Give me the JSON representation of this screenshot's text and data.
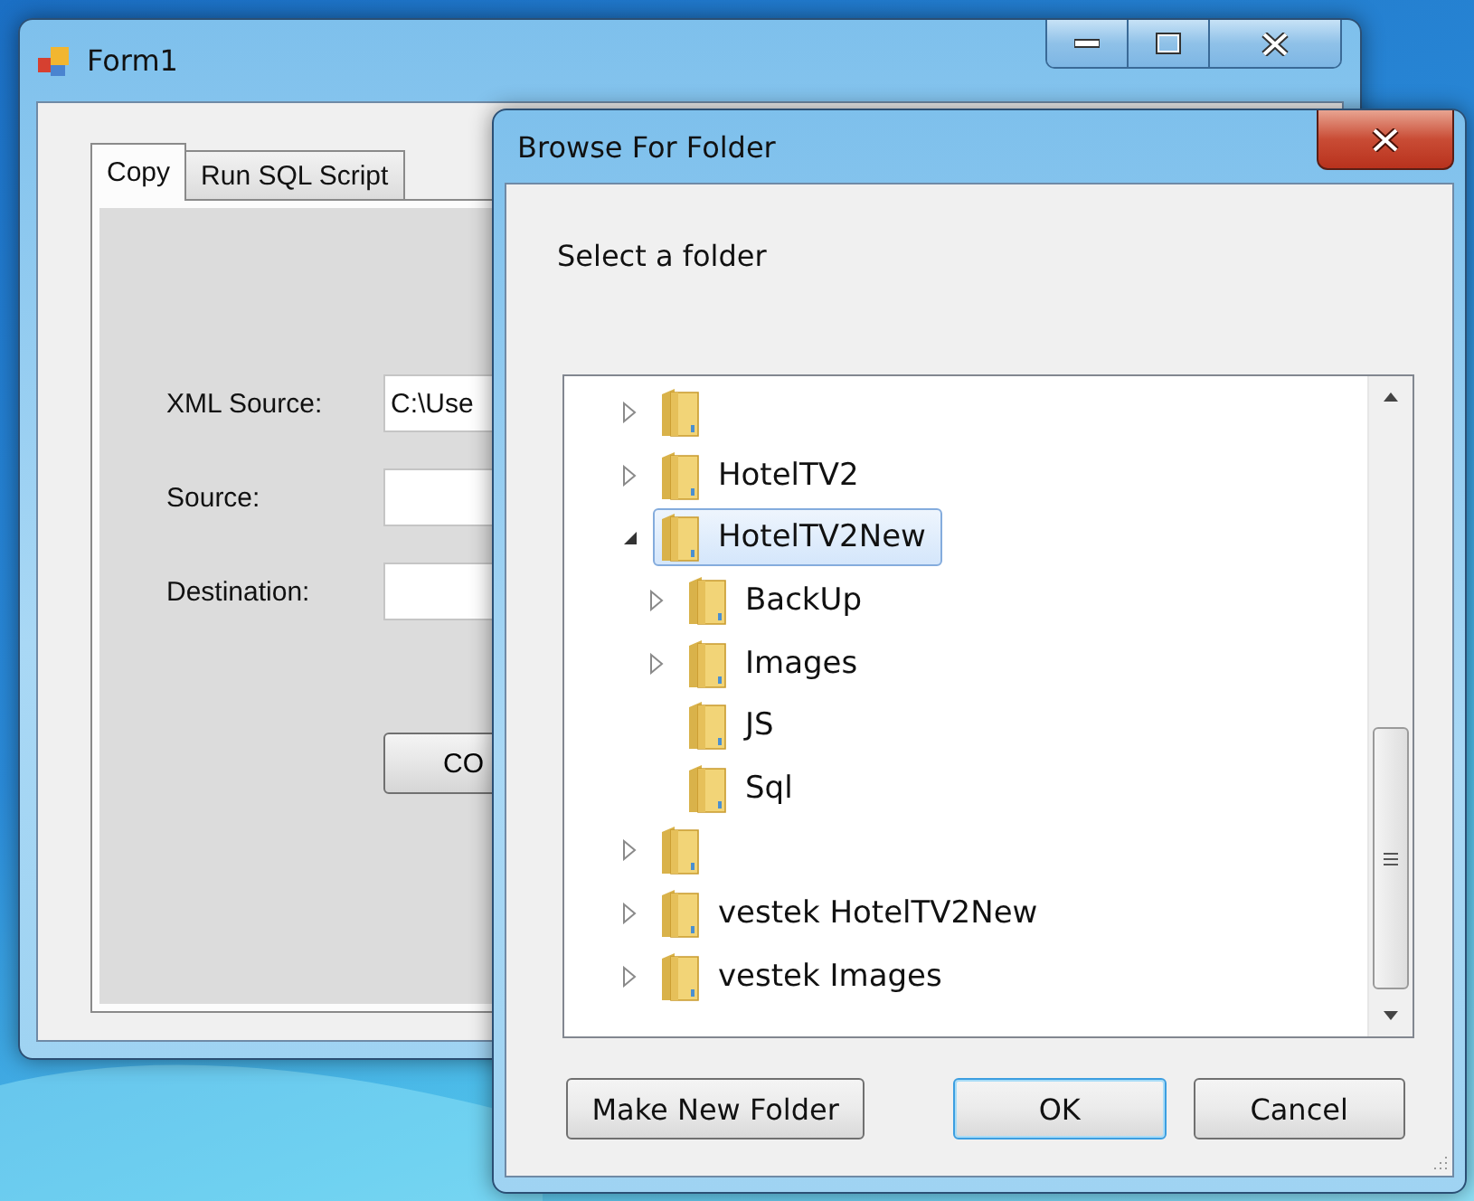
{
  "main_window": {
    "title": "Form1",
    "tabs": [
      {
        "label": "Copy",
        "selected": true
      },
      {
        "label": "Run SQL Script",
        "selected": false
      }
    ],
    "fields": [
      {
        "label": "XML Source:",
        "value": "C:\\Use"
      },
      {
        "label": "Source:"
      },
      {
        "label": "Destination:"
      }
    ],
    "button": "CO"
  },
  "dialog": {
    "title": "Browse For Folder",
    "prompt": "Select a folder",
    "tree": [
      {
        "expandable": true,
        "expanded": false,
        "selected": false
      },
      {
        "label": "HotelTV2",
        "expandable": true,
        "expanded": false,
        "selected": false
      },
      {
        "label": "HotelTV2New",
        "expandable": true,
        "expanded": true,
        "selected": true,
        "children": [
          {
            "label": "BackUp",
            "expandable": true,
            "expanded": false,
            "selected": false
          },
          {
            "label": "Images",
            "expandable": true,
            "expanded": false,
            "selected": false
          },
          {
            "label": "JS",
            "expandable": false,
            "selected": false
          },
          {
            "label": "Sql",
            "expandable": false,
            "selected": false
          }
        ]
      },
      {
        "expandable": true,
        "expanded": false,
        "selected": false
      },
      {
        "label": "vestek HotelTV2New",
        "expandable": true,
        "expanded": false,
        "selected": false
      },
      {
        "label": "vestek Images",
        "expandable": true,
        "expanded": false,
        "selected": false
      }
    ],
    "buttons": [
      {
        "label": "Make New Folder",
        "kind": "normal"
      },
      {
        "label": "OK",
        "kind": "default"
      },
      {
        "label": "Cancel",
        "kind": "normal"
      }
    ]
  }
}
